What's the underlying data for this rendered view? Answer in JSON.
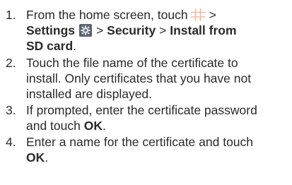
{
  "steps": [
    {
      "number": "1.",
      "line1": {
        "text_before_icon": "From the home screen, touch",
        "apps_icon": "app-grid-icon",
        "after_icon": ">"
      },
      "line2": {
        "settings_label": "Settings",
        "settings_icon": "gear-icon",
        "separator_1": ">",
        "security_label": "Security",
        "separator_2": ">",
        "install_label_part1": "Install from"
      },
      "line3": {
        "install_label_part2": "SD card",
        "end_punct": "."
      }
    },
    {
      "number": "2.",
      "lines": [
        "Touch the file name of the certificate to",
        "install. Only certificates that you have not",
        "installed are displayed."
      ]
    },
    {
      "number": "3.",
      "line1": "If prompted, enter the certificate password",
      "line2_prefix": "and touch ",
      "line2_bold": "OK",
      "line2_suffix": "."
    },
    {
      "number": "4.",
      "line1": "Enter a name for the certificate and touch",
      "line2_bold": "OK",
      "line2_suffix": "."
    }
  ],
  "colors": {
    "text": "#2a2a2a",
    "apps_icon_tint": "#f5b7a1",
    "settings_icon_bg": "#5a6270"
  }
}
